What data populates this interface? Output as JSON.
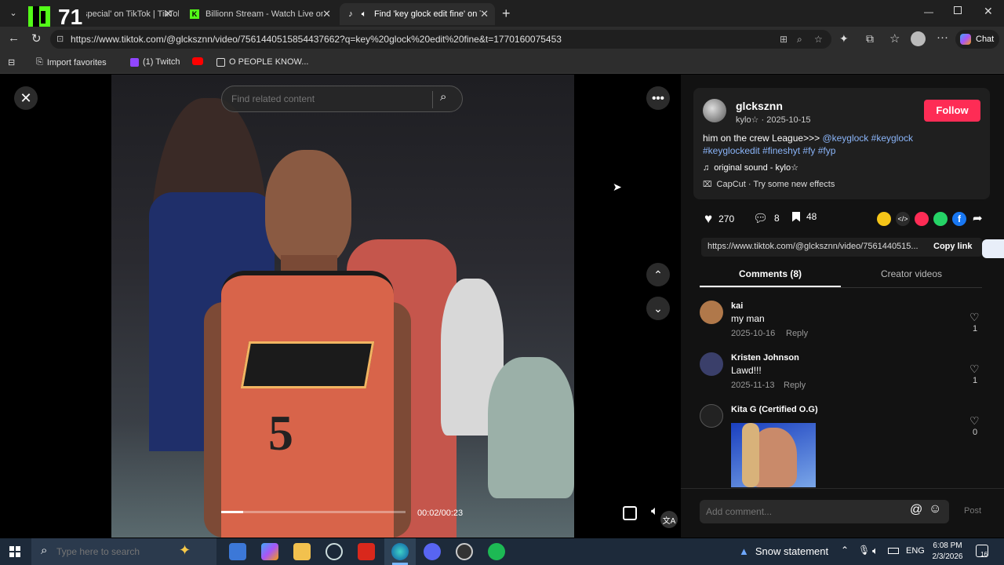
{
  "tabs": [
    {
      "title": "Find 'Hi special' on TikTok | TikTok"
    },
    {
      "title": "Billionn Stream - Watch Live on Kick"
    },
    {
      "title": "Find 'key glock edit fine' on TikTok"
    }
  ],
  "overlay_logo": "71",
  "address": {
    "url": "https://www.tiktok.com/@glcksznn/video/7561440515854437662?q=key%20glock%20edit%20fine&t=1770160075453"
  },
  "browser": {
    "chat_label": "Chat"
  },
  "favorites": [
    {
      "label": "Import favorites"
    },
    {
      "label": "(1) Twitch"
    },
    {
      "label": ""
    },
    {
      "label": "O PEOPLE KNOW..."
    }
  ],
  "video": {
    "search_placeholder": "Find related content",
    "time": "00:02/00:23",
    "jersey_number": "5",
    "progress": 0.12
  },
  "post": {
    "username": "glcksznn",
    "nickname": "kylo☆",
    "date": "2025-10-15",
    "follow_label": "Follow",
    "caption_text": "him on the crew League>>> ",
    "caption_tags": "@keyglock #keyglock #keyglockedit #fineshyt #fy #fyp",
    "sound": "original sound - kylo☆",
    "effect": "CapCut · Try some new effects",
    "likes": "270",
    "comments": "8",
    "saves": "48",
    "share_url": "https://www.tiktok.com/@glcksznn/video/7561440515...",
    "copy_label": "Copy link"
  },
  "tabs_side": {
    "comments": "Comments (8)",
    "creator": "Creator videos"
  },
  "comments": [
    {
      "user": "kai",
      "text": "my man",
      "date": "2025-10-16",
      "reply": "Reply",
      "likes": "1"
    },
    {
      "user": "Kristen Johnson",
      "text": "Lawd!!!",
      "date": "2025-11-13",
      "reply": "Reply",
      "likes": "1"
    },
    {
      "user": "Kita G (Certified O.G)",
      "text": "",
      "date": "",
      "reply": "",
      "likes": "0"
    }
  ],
  "comment_input": {
    "placeholder": "Add comment...",
    "post_label": "Post"
  },
  "taskbar": {
    "search_placeholder": "Type here to search",
    "weather": "Snow statement",
    "lang": "ENG",
    "time": "6:08 PM",
    "date": "2/3/2026",
    "notif_count": "16"
  },
  "colors": {
    "accent": "#fe2c55",
    "link": "#8ab4f8",
    "edge_blue": "#0078d4"
  }
}
